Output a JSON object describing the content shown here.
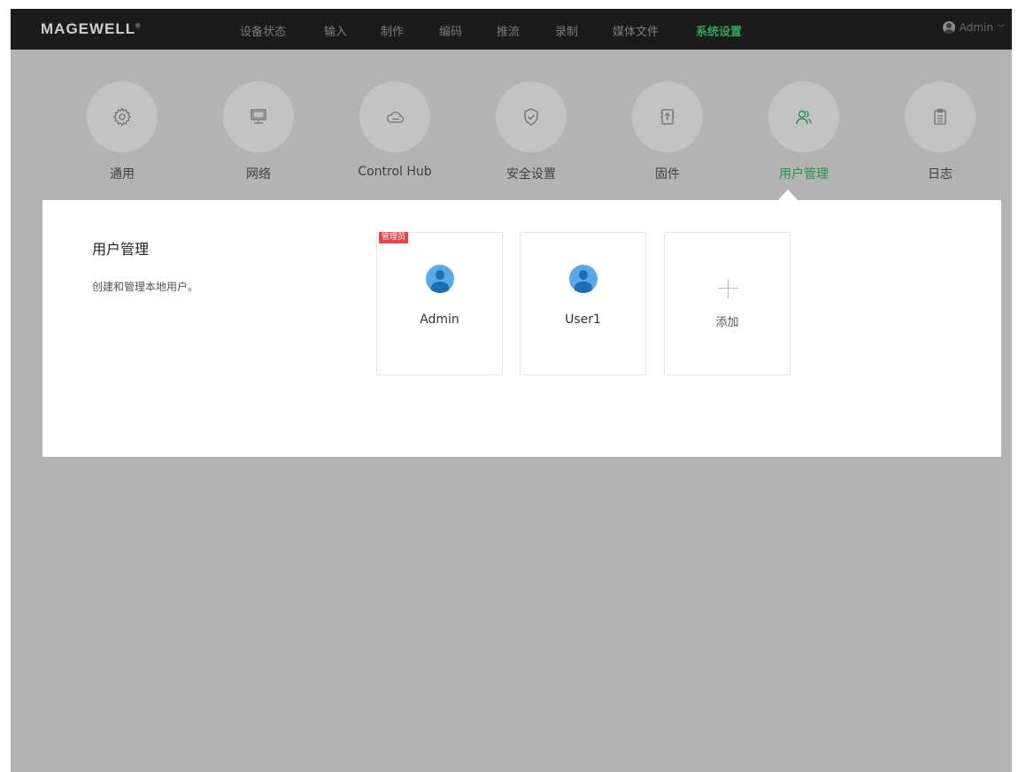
{
  "brand": "MAGEWELL",
  "brand_mark": "®",
  "nav": [
    {
      "label": "设备状态"
    },
    {
      "label": "输入"
    },
    {
      "label": "制作"
    },
    {
      "label": "编码"
    },
    {
      "label": "推流"
    },
    {
      "label": "录制"
    },
    {
      "label": "媒体文件"
    },
    {
      "label": "系统设置"
    }
  ],
  "nav_active": "系统设置",
  "user_menu": {
    "label": "Admin",
    "chevron": "﹀"
  },
  "categories": [
    {
      "label": "通用",
      "icon": "gear-icon"
    },
    {
      "label": "网络",
      "icon": "monitor-icon"
    },
    {
      "label": "Control Hub",
      "icon": "cloud-icon"
    },
    {
      "label": "安全设置",
      "icon": "shield-icon"
    },
    {
      "label": "固件",
      "icon": "firmware-icon"
    },
    {
      "label": "用户管理",
      "icon": "users-icon"
    },
    {
      "label": "日志",
      "icon": "clipboard-icon"
    }
  ],
  "category_active": "用户管理",
  "panel": {
    "title": "用户管理",
    "description": "创建和管理本地用户。"
  },
  "users": [
    {
      "name": "Admin",
      "badge": "管理员"
    },
    {
      "name": "User1"
    }
  ],
  "add_card": {
    "label": "添加"
  },
  "colors": {
    "accent": "#2fa35c",
    "badge": "#e14547",
    "avatar": "#5aa9e6",
    "overlay": "#b3b3b3",
    "topbar": "#1b1b1b"
  }
}
